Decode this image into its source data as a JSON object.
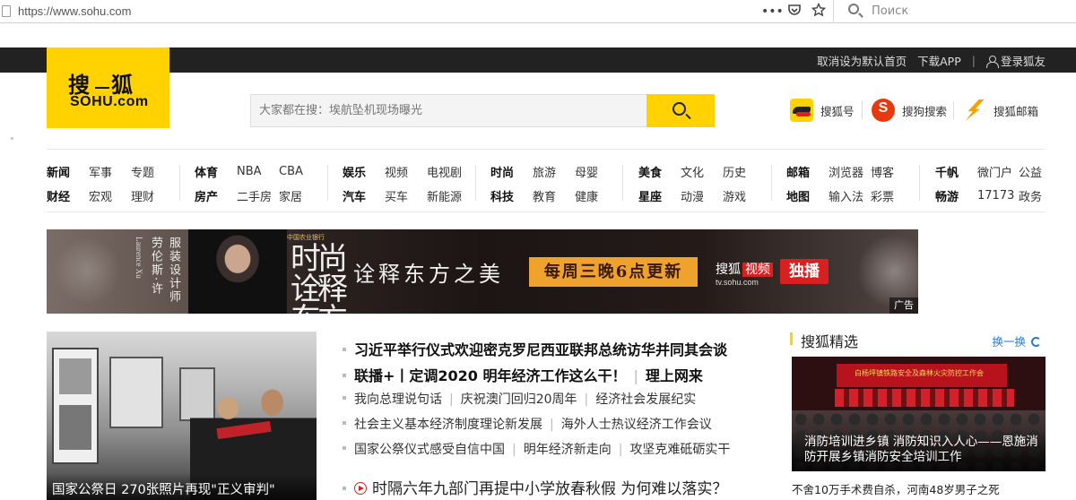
{
  "browser": {
    "url": "https://www.sohu.com",
    "menu_glyph": "•••",
    "search_placeholder": "Поиск"
  },
  "topbar": {
    "links": [
      "取消设为默认首页",
      "下载APP",
      "登录狐友"
    ],
    "separator": "|"
  },
  "logo": {
    "cn_left": "搜",
    "cn_right": "狐",
    "en": "SOHU.com"
  },
  "search": {
    "placeholder": "大家都在搜：埃航坠机现场曝光"
  },
  "services": [
    {
      "label": "搜狐号",
      "icon": "sohu-hao-icon"
    },
    {
      "label": "搜狗搜索",
      "icon": "sogou-icon"
    },
    {
      "label": "搜狐邮箱",
      "icon": "mail-icon"
    }
  ],
  "nav": [
    {
      "rows": [
        [
          "新闻",
          "军事",
          "专题"
        ],
        [
          "财经",
          "宏观",
          "理财"
        ]
      ]
    },
    {
      "rows": [
        [
          "体育",
          "NBA",
          "CBA"
        ],
        [
          "房产",
          "二手房",
          "家居"
        ]
      ]
    },
    {
      "rows": [
        [
          "娱乐",
          "视频",
          "电视剧"
        ],
        [
          "汽车",
          "买车",
          "新能源"
        ]
      ]
    },
    {
      "rows": [
        [
          "时尚",
          "旅游",
          "母婴"
        ],
        [
          "科技",
          "教育",
          "健康"
        ]
      ]
    },
    {
      "rows": [
        [
          "美食",
          "文化",
          "历史"
        ],
        [
          "星座",
          "动漫",
          "游戏"
        ]
      ]
    },
    {
      "rows": [
        [
          "邮箱",
          "浏览器",
          "博客"
        ],
        [
          "地图",
          "输入法",
          "彩票"
        ]
      ]
    },
    {
      "rows": [
        [
          "千帆",
          "微门户",
          "公益"
        ],
        [
          "畅游",
          "17173",
          "政务"
        ]
      ]
    }
  ],
  "banner": {
    "person_name": "劳伦斯·许",
    "person_name_en": "Laurence Xu",
    "role": "服装设计师",
    "bank": "中国农业银行",
    "show_title": "时尚诠释东方美",
    "slogan": "诠释东方之美",
    "schedule": "每周三晚6点更新",
    "brand": "搜狐",
    "brand_video": "视频",
    "brand_url": "tv.sohu.com",
    "exclusive": "独播",
    "ad_label": "广告"
  },
  "main_photo": {
    "caption": "国家公祭日 270张照片再现\"正义审判\""
  },
  "headlines": {
    "top": "习近平举行仪式欢迎密克罗尼西亚联邦总统访华并同其会谈",
    "second": [
      "联播+丨定调2020 明年经济工作这么干！",
      "理上网来"
    ],
    "rows": [
      [
        "我向总理说句话",
        "庆祝澳门回归20周年",
        "经济社会发展纪实"
      ],
      [
        "社会主义基本经济制度理论新发展",
        "海外人士热议经济工作会议"
      ],
      [
        "国家公祭仪式感受自信中国",
        "明年经济新走向",
        "攻坚克难砥砺实干"
      ]
    ],
    "video": "时隔六年九部门再提中小学放春秋假 为何难以落实？"
  },
  "picks": {
    "title": "搜狐精选",
    "refresh": "换一换",
    "image_caption": "消防培训进乡镇 消防知识入人心——恩施消防开展乡镇消防安全培训工作",
    "stage_text": "白杨坪镇铁路安全及森林火灾防控工作会",
    "line1": "不舍10万手术费自杀，河南48岁男子之死"
  }
}
